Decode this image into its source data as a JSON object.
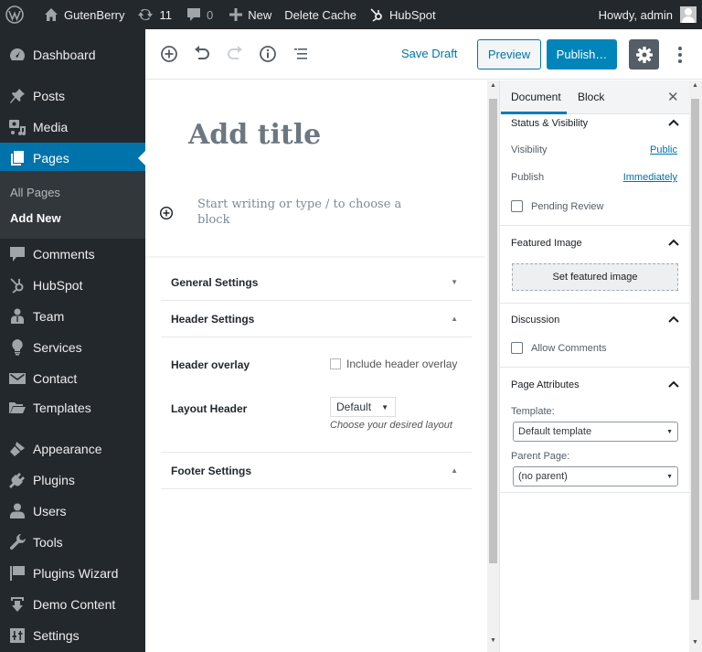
{
  "admin_bar": {
    "wp_logo_icon": "wordpress-logo-icon",
    "site_name": "GutenBerry",
    "updates_count": "11",
    "comments_count": "0",
    "new_label": "New",
    "delete_cache_label": "Delete Cache",
    "hubspot_label": "HubSpot",
    "greeting": "Howdy, admin"
  },
  "sidebar": {
    "items": [
      {
        "label": "Dashboard",
        "icon": "dashboard-icon"
      },
      {
        "label": "Posts",
        "icon": "pin-icon"
      },
      {
        "label": "Media",
        "icon": "media-icon"
      },
      {
        "label": "Pages",
        "icon": "pages-icon",
        "active": true
      },
      {
        "label": "Comments",
        "icon": "comment-icon"
      },
      {
        "label": "HubSpot",
        "icon": "hubspot-icon"
      },
      {
        "label": "Team",
        "icon": "team-icon"
      },
      {
        "label": "Services",
        "icon": "lightbulb-icon"
      },
      {
        "label": "Contact",
        "icon": "envelope-icon"
      },
      {
        "label": "Templates",
        "icon": "folder-icon"
      },
      {
        "label": "Appearance",
        "icon": "brush-icon"
      },
      {
        "label": "Plugins",
        "icon": "plug-icon"
      },
      {
        "label": "Users",
        "icon": "user-icon"
      },
      {
        "label": "Tools",
        "icon": "wrench-icon"
      },
      {
        "label": "Plugins Wizard",
        "icon": "flag-icon"
      },
      {
        "label": "Demo Content",
        "icon": "download-icon"
      },
      {
        "label": "Settings",
        "icon": "sliders-icon"
      }
    ],
    "submenu": [
      {
        "label": "All Pages"
      },
      {
        "label": "Add New",
        "current": true
      }
    ]
  },
  "toolbar": {
    "save_draft": "Save Draft",
    "preview": "Preview",
    "publish": "Publish…"
  },
  "editor": {
    "title_placeholder": "Add title",
    "block_placeholder": "Start writing or type / to choose a block"
  },
  "metaboxes": {
    "general_settings": "General Settings",
    "header_settings": "Header Settings",
    "header_overlay_label": "Header overlay",
    "header_overlay_checkbox": "Include header overlay",
    "layout_header_label": "Layout Header",
    "layout_header_value": "Default",
    "layout_header_desc": "Choose your desired layout",
    "footer_settings": "Footer Settings"
  },
  "panel": {
    "tabs": {
      "document": "Document",
      "block": "Block"
    },
    "status": {
      "title": "Status & Visibility",
      "visibility_label": "Visibility",
      "visibility_value": "Public",
      "publish_label": "Publish",
      "publish_value": "Immediately",
      "pending_review": "Pending Review"
    },
    "featured_image": {
      "title": "Featured Image",
      "button": "Set featured image"
    },
    "discussion": {
      "title": "Discussion",
      "allow_comments": "Allow Comments"
    },
    "page_attributes": {
      "title": "Page Attributes",
      "template_label": "Template:",
      "template_value": "Default template",
      "parent_label": "Parent Page:",
      "parent_value": "(no parent)"
    }
  },
  "colors": {
    "admin_bg": "#23282d",
    "accent": "#0073aa",
    "publish_bg": "#0085ba",
    "settings_btn_bg": "#555d66"
  }
}
